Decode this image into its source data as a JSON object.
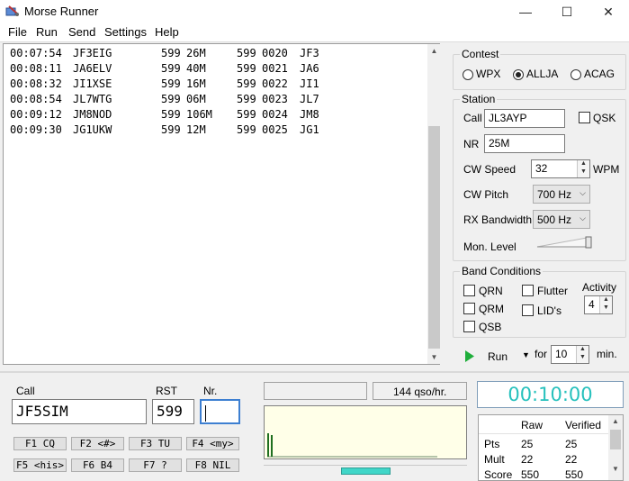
{
  "window": {
    "title": "Morse Runner",
    "minimize": "—",
    "maximize": "☐",
    "close": "✕"
  },
  "menu": [
    "File",
    "Run",
    "Send",
    "Settings",
    "Help"
  ],
  "log": {
    "rows": [
      {
        "time": "00:07:54",
        "call": "JF3EIG",
        "rst_sent": "599",
        "nr_sent": "26M",
        "rst_rcvd": "599",
        "nr_rcvd": "0020",
        "pfx": "JF3"
      },
      {
        "time": "00:08:11",
        "call": "JA6ELV",
        "rst_sent": "599",
        "nr_sent": "40M",
        "rst_rcvd": "599",
        "nr_rcvd": "0021",
        "pfx": "JA6"
      },
      {
        "time": "00:08:32",
        "call": "JI1XSE",
        "rst_sent": "599",
        "nr_sent": "16M",
        "rst_rcvd": "599",
        "nr_rcvd": "0022",
        "pfx": "JI1"
      },
      {
        "time": "00:08:54",
        "call": "JL7WTG",
        "rst_sent": "599",
        "nr_sent": "06M",
        "rst_rcvd": "599",
        "nr_rcvd": "0023",
        "pfx": "JL7"
      },
      {
        "time": "00:09:12",
        "call": "JM8NOD",
        "rst_sent": "599",
        "nr_sent": "106M",
        "rst_rcvd": "599",
        "nr_rcvd": "0024",
        "pfx": "JM8"
      },
      {
        "time": "00:09:30",
        "call": "JG1UKW",
        "rst_sent": "599",
        "nr_sent": "12M",
        "rst_rcvd": "599",
        "nr_rcvd": "0025",
        "pfx": "JG1"
      }
    ]
  },
  "contest": {
    "label": "Contest",
    "options": [
      "WPX",
      "ALLJA",
      "ACAG"
    ],
    "selected": "ALLJA"
  },
  "station": {
    "label": "Station",
    "call_label": "Call",
    "call_value": "JL3AYP",
    "qsk_label": "QSK",
    "nr_label": "NR",
    "nr_value": "25M",
    "cw_speed_label": "CW Speed",
    "cw_speed_value": "32",
    "wpm_label": "WPM",
    "cw_pitch_label": "CW Pitch",
    "cw_pitch_value": "700 Hz",
    "rx_bw_label": "RX Bandwidth",
    "rx_bw_value": "500 Hz",
    "mon_level_label": "Mon. Level",
    "mon_level": 1.0
  },
  "band": {
    "label": "Band Conditions",
    "qrn": "QRN",
    "qrm": "QRM",
    "qsb": "QSB",
    "flutter": "Flutter",
    "lids": "LID's",
    "activity_label": "Activity",
    "activity_value": "4"
  },
  "run": {
    "label": "Run",
    "for_label": "for",
    "minutes": "10",
    "min_label": "min."
  },
  "entry": {
    "call_label": "Call",
    "call_value": "JF5SIM",
    "rst_label": "RST",
    "rst_value": "599",
    "nr_label": "Nr.",
    "nr_value": ""
  },
  "fkeys": [
    "F1 CQ",
    "F2 <#>",
    "F3 TU",
    "F4 <my>",
    "F5 <his>",
    "F6 B4",
    "F7 ?",
    "F8 NIL"
  ],
  "status": {
    "rate": "144 qso/hr."
  },
  "clock": "00:10:00",
  "score": {
    "headers": [
      "Raw",
      "Verified"
    ],
    "rows": [
      {
        "label": "Pts",
        "raw": "25",
        "verified": "25"
      },
      {
        "label": "Mult",
        "raw": "22",
        "verified": "22"
      },
      {
        "label": "Score",
        "raw": "550",
        "verified": "550"
      }
    ]
  },
  "colors": {
    "clock": "#27c1bd",
    "run_icon": "#1fae3b",
    "signal": "#1f6f1f",
    "progress": "#40d6c8"
  }
}
